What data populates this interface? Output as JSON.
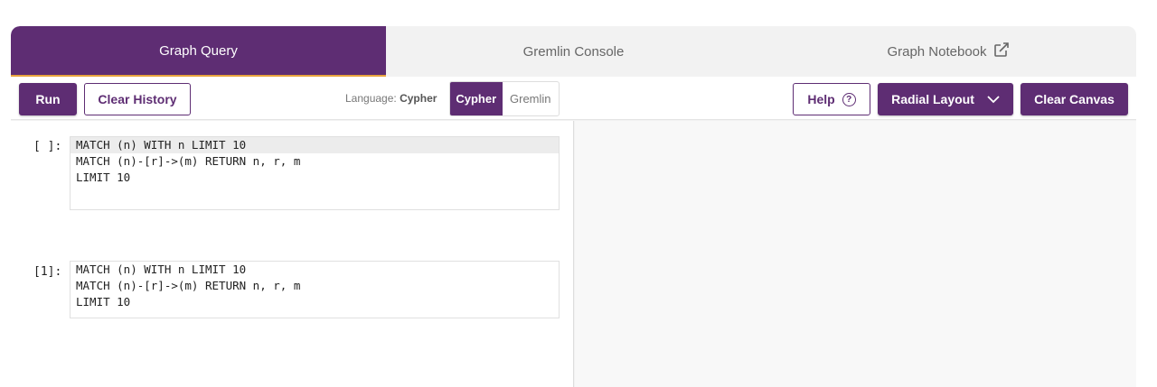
{
  "tabs": [
    {
      "label": "Graph Query"
    },
    {
      "label": "Gremlin Console"
    },
    {
      "label": "Graph Notebook"
    }
  ],
  "toolbar": {
    "run_label": "Run",
    "clear_history_label": "Clear History",
    "language_prefix": "Language:",
    "language_value": "Cypher",
    "lang_options": [
      "Cypher",
      "Gremlin"
    ],
    "help_label": "Help",
    "layout_label": "Radial Layout",
    "clear_canvas_label": "Clear Canvas"
  },
  "cells": [
    {
      "prompt": "[ ]:",
      "lines": [
        "MATCH (n) WITH n LIMIT 10",
        "MATCH (n)-[r]->(m) RETURN n, r, m",
        "LIMIT 10"
      ]
    },
    {
      "prompt": "[1]:",
      "lines": [
        "MATCH (n) WITH n LIMIT 10",
        "MATCH (n)-[r]->(m) RETURN n, r, m",
        "LIMIT 10"
      ]
    }
  ],
  "colors": {
    "brand": "#5e2d73",
    "accent": "#e8a33d"
  }
}
